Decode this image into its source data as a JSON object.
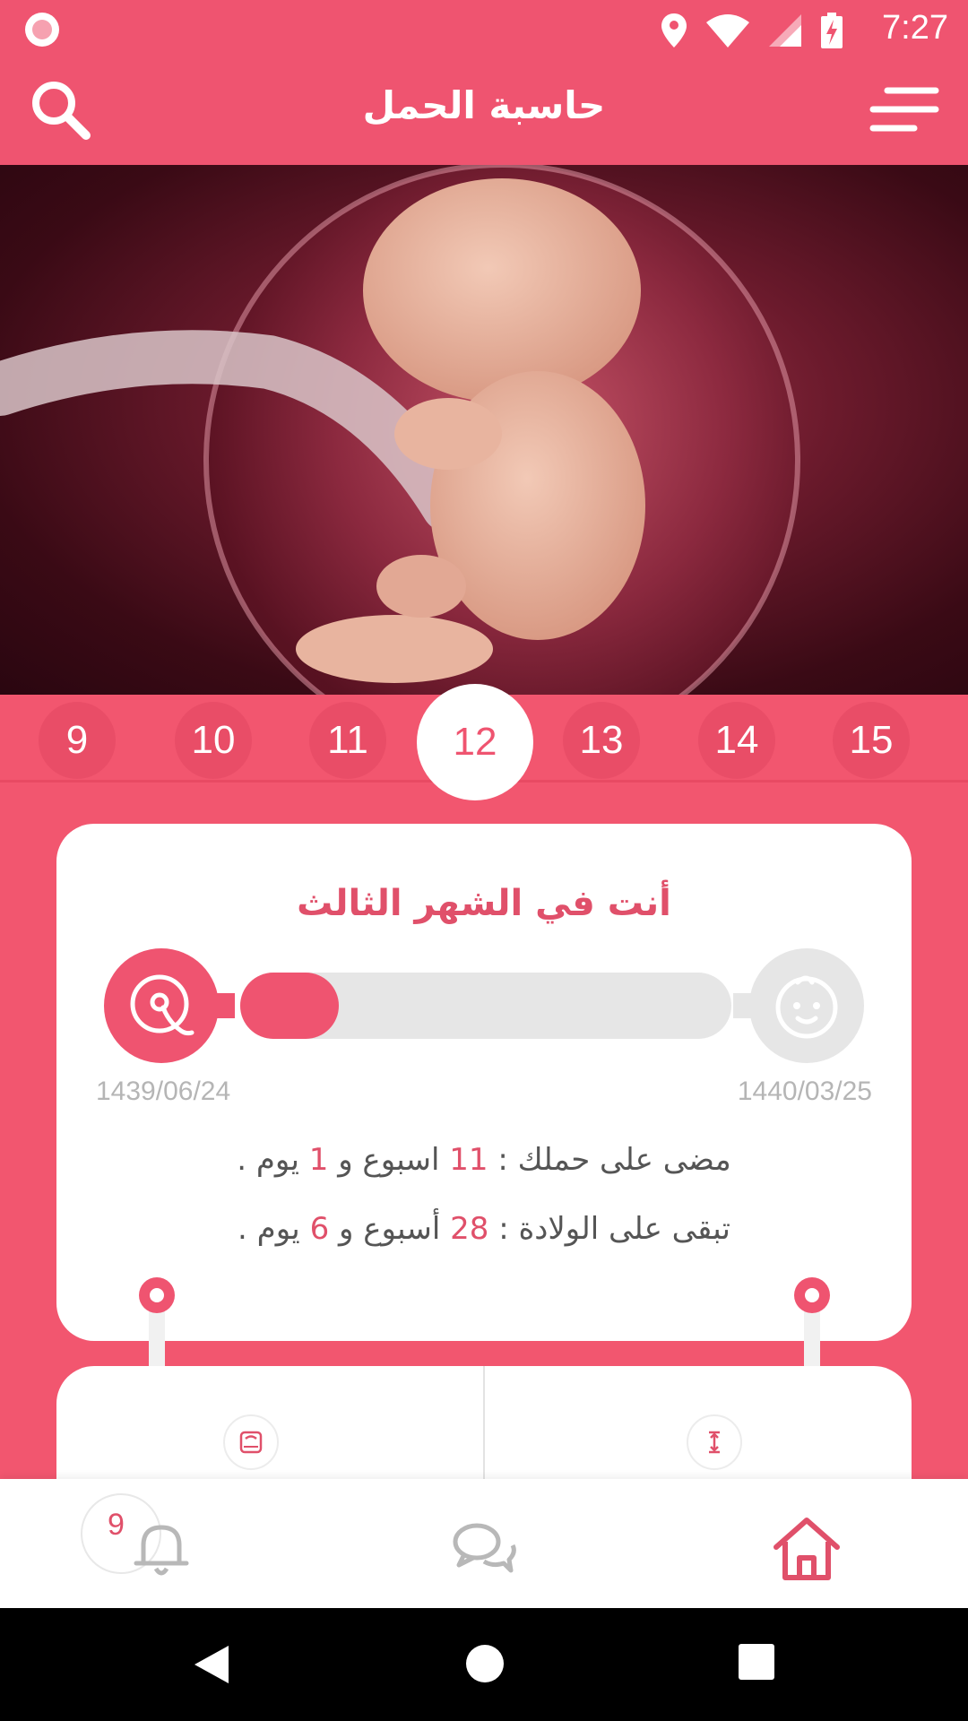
{
  "status_bar": {
    "time": "7:27"
  },
  "app_bar": {
    "title": "حاسبة الحمل"
  },
  "weeks": {
    "items": [
      "9",
      "10",
      "11",
      "12",
      "13",
      "14",
      "15"
    ],
    "selected": "12"
  },
  "progress_card": {
    "month_title": "أنت في الشهر الثالث",
    "start_date": "1439/06/24",
    "end_date": "1440/03/25",
    "progress_fraction": 0.2,
    "elapsed": {
      "label": "مضى على حملك :",
      "weeks": "11",
      "weeks_word": "اسبوع و",
      "days": "1",
      "days_word": "يوم ."
    },
    "remaining": {
      "label": "تبقى على الولادة :",
      "weeks": "28",
      "weeks_word": "أسبوع و",
      "days": "6",
      "days_word": "يوم ."
    }
  },
  "bottom_nav": {
    "notifications_count": "9",
    "items": [
      "bell-icon",
      "chat-icon",
      "home-icon"
    ]
  },
  "colors": {
    "primary": "#ef5470",
    "accent_text": "#e0506a",
    "track": "#e6e6e6"
  }
}
